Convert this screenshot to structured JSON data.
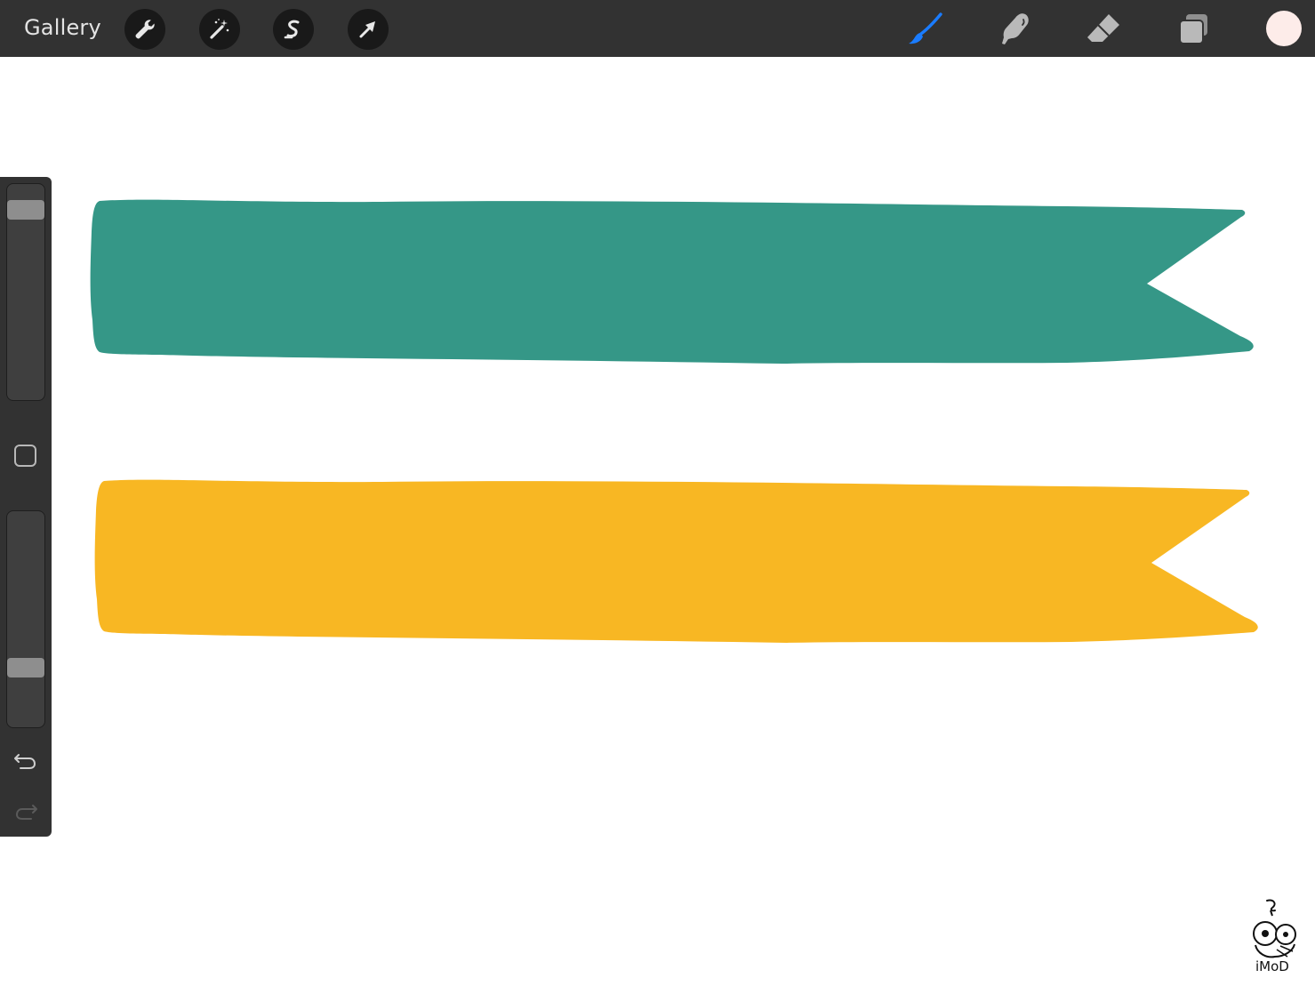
{
  "app": {
    "gallery_label": "Gallery"
  },
  "toolbar": {
    "left_tools": [
      {
        "name": "actions",
        "icon": "wrench-icon"
      },
      {
        "name": "adjustments",
        "icon": "magic-wand-icon"
      },
      {
        "name": "selection",
        "icon": "selection-s-icon"
      },
      {
        "name": "transform",
        "icon": "arrow-cursor-icon"
      }
    ],
    "right_tools": [
      {
        "name": "brush",
        "icon": "brush-icon",
        "active": true
      },
      {
        "name": "smudge",
        "icon": "smudge-finger-icon",
        "active": false
      },
      {
        "name": "eraser",
        "icon": "eraser-icon",
        "active": false
      },
      {
        "name": "layers",
        "icon": "layers-icon",
        "active": false
      }
    ],
    "current_color": "#fdece9",
    "active_color": "#1a7cff",
    "inactive_color": "#b9b9b9"
  },
  "sidebar": {
    "brush_size_level": 0.03,
    "opacity_level": 0.73,
    "modify_icon": "square-modify-icon",
    "undo_icon": "undo-arrow-icon",
    "redo_icon": "redo-arrow-icon"
  },
  "canvas": {
    "background": "#ffffff",
    "ribbons": [
      {
        "name": "teal-ribbon",
        "color": "#359787"
      },
      {
        "name": "yellow-ribbon",
        "color": "#f8b723"
      }
    ]
  },
  "watermark": {
    "text": "iMoD"
  }
}
